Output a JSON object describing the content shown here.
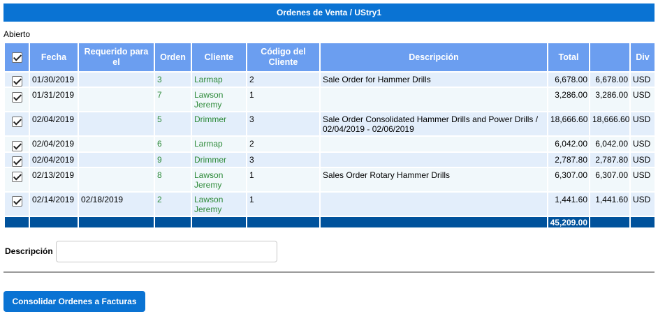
{
  "header": {
    "title": "Ordenes de Venta / UStry1"
  },
  "status": "Abierto",
  "columns": {
    "fecha": "Fecha",
    "requerido": "Requerido para el",
    "orden": "Orden",
    "cliente": "Cliente",
    "codigo": "Código del Cliente",
    "descripcion": "Descripción",
    "total": "Total",
    "total2": "",
    "div": "Div"
  },
  "rows": [
    {
      "fecha": "01/30/2019",
      "requerido": "",
      "orden": "3",
      "cliente": "Larmap",
      "codigo": "2",
      "descripcion": "Sale Order for Hammer Drills",
      "total": "6,678.00",
      "total2": "6,678.00",
      "div": "USD",
      "checked": true
    },
    {
      "fecha": "01/31/2019",
      "requerido": "",
      "orden": "7",
      "cliente": "Lawson Jeremy",
      "codigo": "1",
      "descripcion": "",
      "total": "3,286.00",
      "total2": "3,286.00",
      "div": "USD",
      "checked": true
    },
    {
      "fecha": "02/04/2019",
      "requerido": "",
      "orden": "5",
      "cliente": "Drimmer",
      "codigo": "3",
      "descripcion": "Sale Order Consolidated Hammer Drills and Power Drills / 02/04/2019 - 02/06/2019",
      "total": "18,666.60",
      "total2": "18,666.60",
      "div": "USD",
      "checked": true
    },
    {
      "fecha": "02/04/2019",
      "requerido": "",
      "orden": "6",
      "cliente": "Larmap",
      "codigo": "2",
      "descripcion": "",
      "total": "6,042.00",
      "total2": "6,042.00",
      "div": "USD",
      "checked": true
    },
    {
      "fecha": "02/04/2019",
      "requerido": "",
      "orden": "9",
      "cliente": "Drimmer",
      "codigo": "3",
      "descripcion": "",
      "total": "2,787.80",
      "total2": "2,787.80",
      "div": "USD",
      "checked": true
    },
    {
      "fecha": "02/13/2019",
      "requerido": "",
      "orden": "8",
      "cliente": "Lawson Jeremy",
      "codigo": "1",
      "descripcion": "Sales Order Rotary Hammer Drills",
      "total": "6,307.00",
      "total2": "6,307.00",
      "div": "USD",
      "checked": true
    },
    {
      "fecha": "02/14/2019",
      "requerido": "02/18/2019",
      "orden": "2",
      "cliente": "Lawson Jeremy",
      "codigo": "1",
      "descripcion": "",
      "total": "1,441.60",
      "total2": "1,441.60",
      "div": "USD",
      "checked": true
    }
  ],
  "totals": {
    "total": "45,209.00"
  },
  "form": {
    "descripcion_label": "Descripción",
    "descripcion_value": ""
  },
  "actions": {
    "consolidate_label": "Consolidar Ordenes a Facturas"
  },
  "colors": {
    "title_bg": "#0a73d3",
    "header_bg": "#6b9ef0",
    "total_bg": "#00529c",
    "link": "#2e8b3a"
  },
  "icons": {
    "checkbox": "checkbox-checked-icon"
  }
}
